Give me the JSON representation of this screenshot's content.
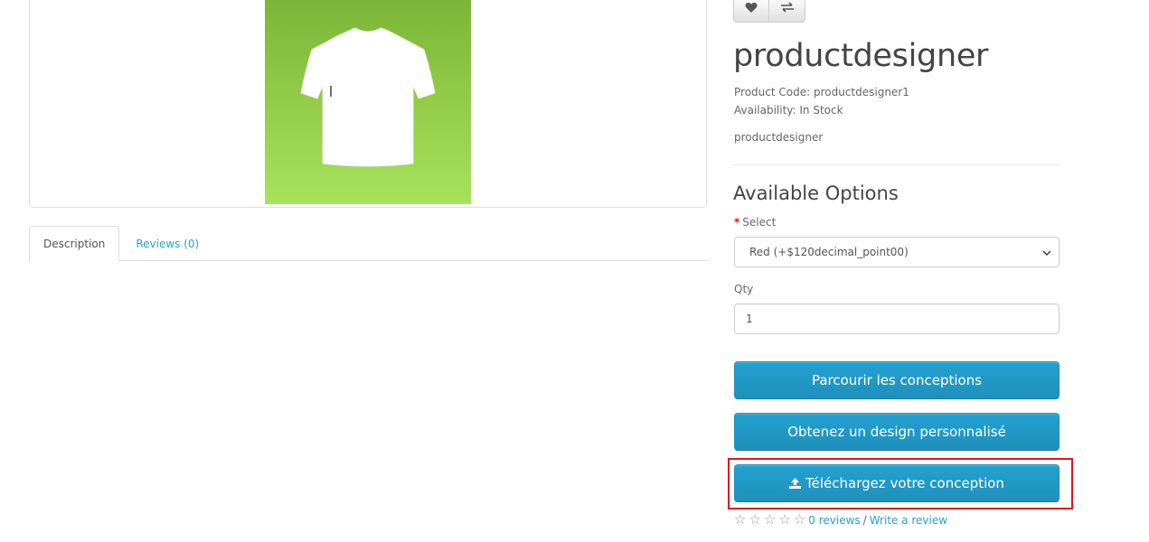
{
  "product": {
    "title": "productdesigner",
    "product_code_label": "Product Code: productdesigner1",
    "availability_label": "Availability: In Stock",
    "short_description": "productdesigner",
    "image_alt": "white t-shirt on green background"
  },
  "toolbar": {
    "wishlist_icon": "heart-icon",
    "compare_icon": "compare-arrows-icon"
  },
  "tabs": [
    {
      "label": "Description",
      "active": true
    },
    {
      "label": "Reviews (0)",
      "active": false
    }
  ],
  "options": {
    "heading": "Available Options",
    "select_label": "Select",
    "select_required": "*",
    "select_value": "Red (+$120decimal_point00)",
    "qty_label": "Qty",
    "qty_value": "1"
  },
  "buttons": {
    "browse_designs": "Parcourir les conceptions",
    "custom_design": "Obtenez un design personnalisé",
    "upload_design": "Téléchargez votre conception"
  },
  "rating": {
    "stars": 0,
    "max_stars": 5,
    "reviews_link": "0 reviews",
    "separator": "/",
    "write_review_link": "Write a review"
  },
  "colors": {
    "accent": "#23a1d1",
    "highlight": "#e0141e",
    "required": "#ff0000"
  }
}
